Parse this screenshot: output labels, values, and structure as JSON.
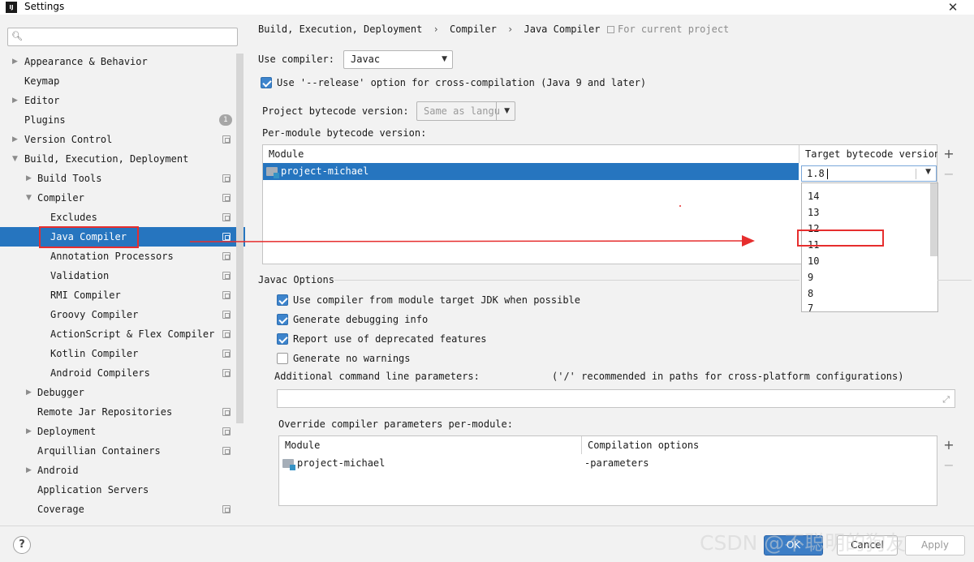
{
  "window": {
    "title": "Settings",
    "app_icon": "IJ"
  },
  "search": {
    "placeholder": ""
  },
  "sidebar": {
    "items": [
      {
        "label": "Appearance & Behavior",
        "arrow": "▶"
      },
      {
        "label": "Keymap"
      },
      {
        "label": "Editor",
        "arrow": "▶"
      },
      {
        "label": "Plugins",
        "badge": "1"
      },
      {
        "label": "Version Control",
        "arrow": "▶"
      },
      {
        "label": "Build, Execution, Deployment",
        "arrow": "▼"
      },
      {
        "label": "Build Tools",
        "arrow": "▶"
      },
      {
        "label": "Compiler",
        "arrow": "▼"
      },
      {
        "label": "Excludes"
      },
      {
        "label": "Java Compiler"
      },
      {
        "label": "Annotation Processors"
      },
      {
        "label": "Validation"
      },
      {
        "label": "RMI Compiler"
      },
      {
        "label": "Groovy Compiler"
      },
      {
        "label": "ActionScript & Flex Compiler"
      },
      {
        "label": "Kotlin Compiler"
      },
      {
        "label": "Android Compilers"
      },
      {
        "label": "Debugger",
        "arrow": "▶"
      },
      {
        "label": "Remote Jar Repositories"
      },
      {
        "label": "Deployment",
        "arrow": "▶"
      },
      {
        "label": "Arquillian Containers"
      },
      {
        "label": "Android",
        "arrow": "▶"
      },
      {
        "label": "Application Servers"
      },
      {
        "label": "Coverage"
      }
    ]
  },
  "breadcrumb": {
    "parts": [
      "Build, Execution, Deployment",
      "Compiler",
      "Java Compiler"
    ],
    "separator": "›",
    "scope": "For current project"
  },
  "compiler": {
    "use_label": "Use compiler:",
    "use_value": "Javac",
    "release_label": "Use '--release' option for cross-compilation (Java 9 and later)",
    "release_checked": true,
    "project_bytecode_label": "Project bytecode version:",
    "project_bytecode_value": "Same as langu",
    "per_module_label": "Per-module bytecode version:"
  },
  "module_table": {
    "columns": [
      "Module",
      "Target bytecode version"
    ],
    "rows": [
      {
        "module": "project-michael",
        "version": "1.8"
      }
    ],
    "add": "+",
    "remove": "−"
  },
  "version_dropdown": {
    "options": [
      "14",
      "13",
      "12",
      "11",
      "10",
      "9",
      "8",
      "7"
    ],
    "highlighted": "11"
  },
  "javac": {
    "title": "Javac Options",
    "options": [
      {
        "label": "Use compiler from module target JDK when possible",
        "checked": true
      },
      {
        "label": "Generate debugging info",
        "checked": true
      },
      {
        "label": "Report use of deprecated features",
        "checked": true
      },
      {
        "label": "Generate no warnings",
        "checked": false
      }
    ],
    "additional_label": "Additional command line parameters:",
    "additional_hint": "('/' recommended in paths for cross-platform configurations)",
    "additional_value": "",
    "override_label": "Override compiler parameters per-module:"
  },
  "override_table": {
    "columns": [
      "Module",
      "Compilation options"
    ],
    "rows": [
      {
        "module": "project-michael",
        "options": "-parameters"
      }
    ],
    "add": "+",
    "remove": "−"
  },
  "footer": {
    "help": "?",
    "ok": "OK",
    "cancel": "Cancel",
    "apply": "Apply",
    "watermark": "CSDN @不聪明的狗友"
  },
  "colors": {
    "selection": "#2675bf",
    "annotation_red": "#e62e2e",
    "checkbox": "#3d84cc"
  },
  "icons": {
    "search": "search-icon",
    "close": "close-icon",
    "copy": "project-scope-icon",
    "folder": "module-folder-icon",
    "dropdown": "chevron-down-icon",
    "expand": "expand-icon",
    "help": "help-icon"
  }
}
